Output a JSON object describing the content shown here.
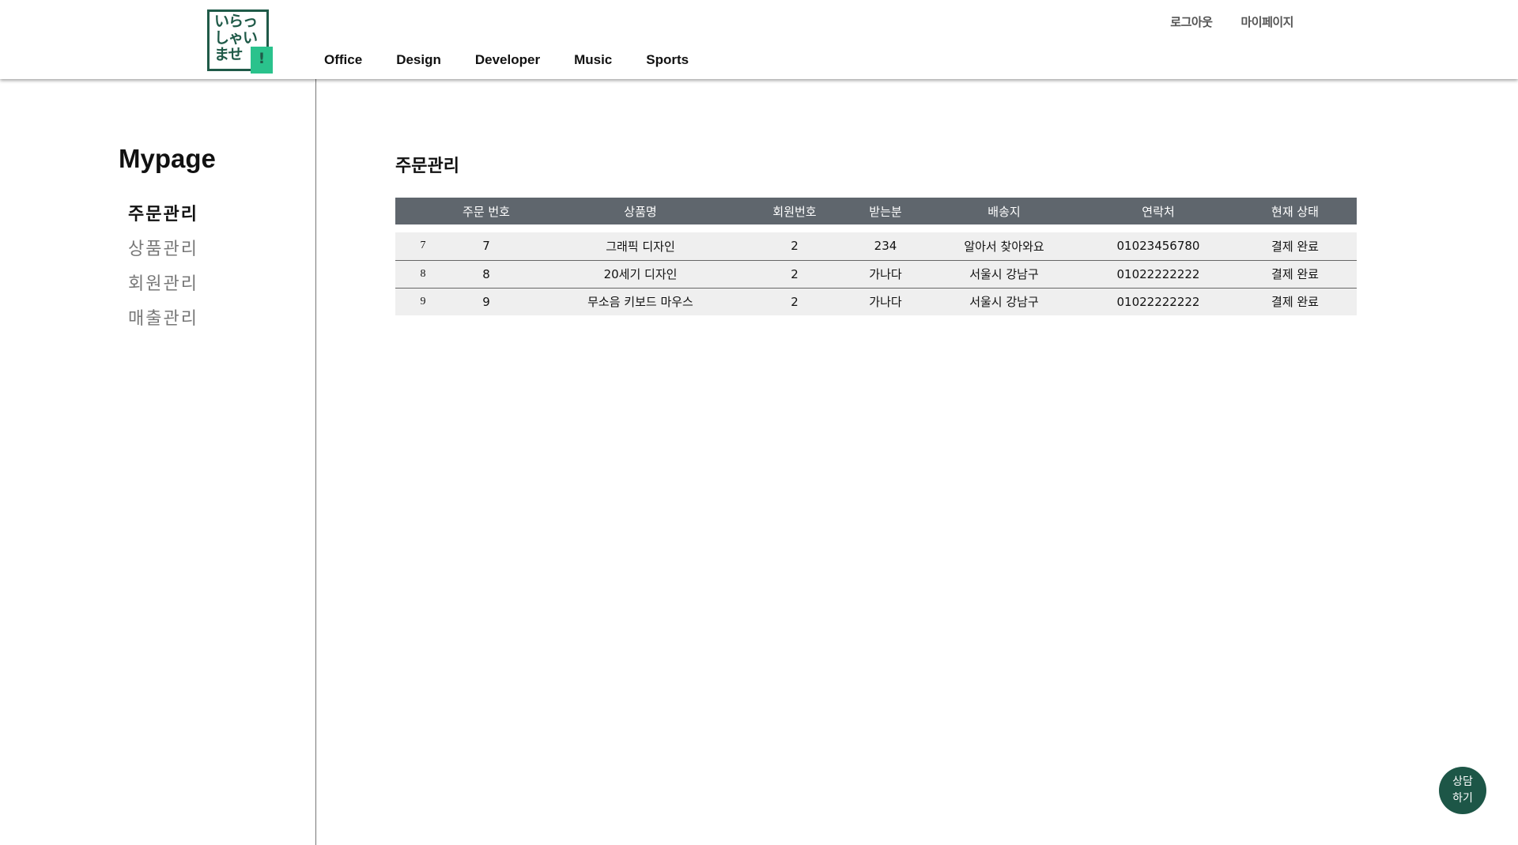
{
  "header": {
    "logo": {
      "lines": [
        "いらっ",
        "しゃい",
        "ませ"
      ],
      "mark": "!"
    },
    "nav": [
      "Office",
      "Design",
      "Developer",
      "Music",
      "Sports"
    ],
    "util": {
      "logout": "로그아웃",
      "mypage": "마이페이지"
    }
  },
  "sidebar": {
    "title": "Mypage",
    "items": [
      {
        "label": "주문관리",
        "active": true
      },
      {
        "label": "상품관리",
        "active": false
      },
      {
        "label": "회원관리",
        "active": false
      },
      {
        "label": "매출관리",
        "active": false
      }
    ]
  },
  "main": {
    "title": "주문관리",
    "table": {
      "columns": [
        "",
        "주문 번호",
        "상품명",
        "회원번호",
        "받는분",
        "배송지",
        "연락처",
        "현재 상태"
      ],
      "rows": [
        [
          "7",
          "7",
          "그래픽 디자인",
          "2",
          "234",
          "알아서 찾아와요",
          "01023456780",
          "결제 완료"
        ],
        [
          "8",
          "8",
          "20세기 디자인",
          "2",
          "가나다",
          "서울시 강남구",
          "01022222222",
          "결제 완료"
        ],
        [
          "9",
          "9",
          "무소음 키보드 마우스",
          "2",
          "가나다",
          "서울시 강남구",
          "01022222222",
          "결제 완료"
        ]
      ]
    }
  },
  "chat_button": {
    "line1": "상담",
    "line2": "하기"
  },
  "colors": {
    "brand_green": "#1f5a48",
    "logo_accent": "#2ac28c",
    "table_header": "#5f666d",
    "row_bg": "#efefef"
  }
}
